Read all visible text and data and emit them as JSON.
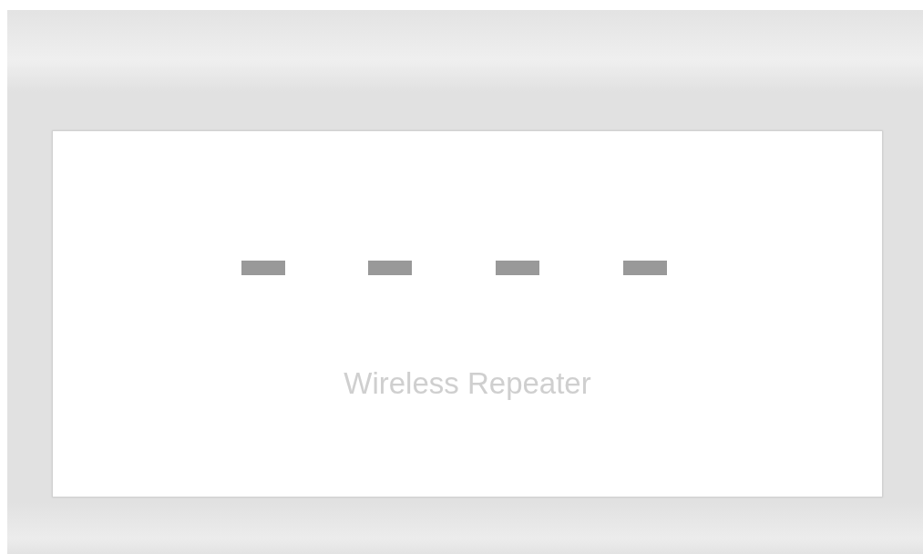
{
  "device": {
    "label": "Wireless Repeater"
  }
}
